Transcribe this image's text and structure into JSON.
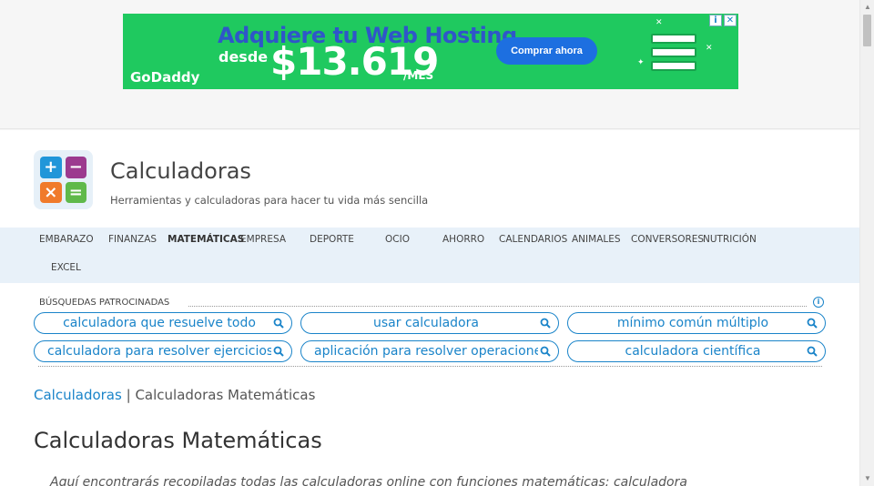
{
  "ad": {
    "headline": "Adquiere tu Web Hosting",
    "desde": "desde",
    "price": "$13.619",
    "per": "/MES",
    "brand": "GoDaddy",
    "button": "Comprar ahora",
    "close_info": "i",
    "close_x": "✕"
  },
  "site": {
    "title": "Calculadoras",
    "tagline": "Herramientas y calculadoras para hacer tu vida más sencilla",
    "logo_glyphs": [
      "+",
      "−",
      "×",
      "="
    ]
  },
  "nav": {
    "items": [
      {
        "label": "EMBARAZO"
      },
      {
        "label": "FINANZAS"
      },
      {
        "label": "MATEMÁTICAS",
        "active": true
      },
      {
        "label": "EMPRESA"
      },
      {
        "label": "DEPORTE"
      },
      {
        "label": "OCIO"
      },
      {
        "label": "AHORRO"
      },
      {
        "label": "CALENDARIOS"
      },
      {
        "label": "ANIMALES"
      },
      {
        "label": "CONVERSORES"
      },
      {
        "label": "NUTRICIÓN"
      },
      {
        "label": "EXCEL"
      }
    ]
  },
  "sponsored": {
    "label": "BÚSQUEDAS PATROCINADAS",
    "info": "i",
    "searches": [
      "calculadora que resuelve todo",
      "usar calculadora",
      "mínimo común múltiplo",
      "calculadora para resolver ejercicios",
      "aplicación para resolver operaciones",
      "calculadora científica"
    ]
  },
  "breadcrumb": {
    "home": "Calculadoras",
    "separator": "|",
    "current": "Calculadoras Matemáticas"
  },
  "page": {
    "heading": "Calculadoras Matemáticas",
    "intro": "Aquí encontrarás recopiladas todas las calculadoras online con funciones matemáticas: calculadora"
  },
  "colors": {
    "ad_green": "#1fc95f",
    "link_blue": "#1a84c9",
    "nav_bg": "#e8f1f9",
    "logo_plus": "#2196d9",
    "logo_minus": "#9c3a8f",
    "logo_times": "#f07a2a",
    "logo_equals": "#5fb94a"
  }
}
